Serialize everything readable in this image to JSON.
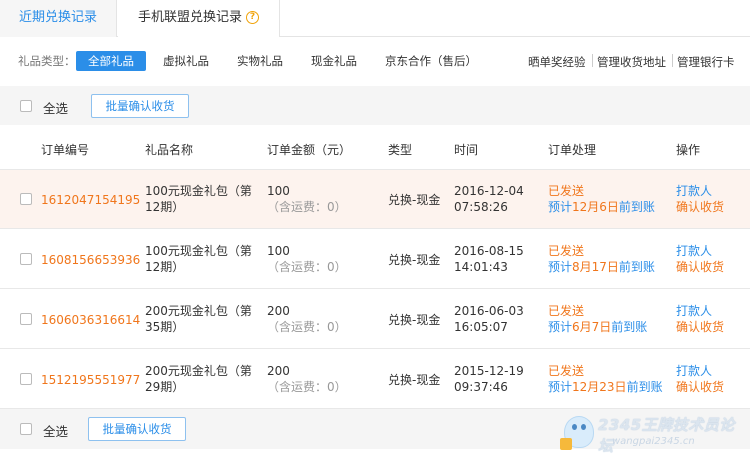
{
  "tabs": [
    {
      "label": "近期兑换记录",
      "active": true
    },
    {
      "label": "手机联盟兑换记录",
      "has_help_icon": true
    }
  ],
  "help_icon_glyph": "?",
  "filter": {
    "label": "礼品类型：",
    "options": [
      "全部礼品",
      "虚拟礼品",
      "实物礼品",
      "现金礼品",
      "京东合作（售后）"
    ],
    "selected": "全部礼品",
    "right_links": [
      "晒单奖经验",
      "管理收货地址",
      "管理银行卡"
    ]
  },
  "select_bar": {
    "select_all_label": "全选",
    "batch_button": "批量确认收货"
  },
  "table": {
    "columns": [
      "订单编号",
      "礼品名称",
      "订单金额（元）",
      "类型",
      "时间",
      "订单处理",
      "操作"
    ],
    "rows": [
      {
        "id": "1612047154195",
        "name1": "100元现金礼包（第",
        "name2": "12期）",
        "amount": "100",
        "fee": "（含运费：0）",
        "type": "兑换-现金",
        "date": "2016-12-04",
        "time": "07:58:26",
        "status": "已发送",
        "eta_prefix": "预计",
        "eta_date": "12月6日",
        "eta_suffix": "前到账",
        "action1": "打款人",
        "action2": "确认收货",
        "highlighted": true
      },
      {
        "id": "1608156653936",
        "name1": "100元现金礼包（第",
        "name2": "12期）",
        "amount": "100",
        "fee": "（含运费：0）",
        "type": "兑换-现金",
        "date": "2016-08-15",
        "time": "14:01:43",
        "status": "已发送",
        "eta_prefix": "预计",
        "eta_date": "8月17日",
        "eta_suffix": "前到账",
        "action1": "打款人",
        "action2": "确认收货",
        "highlighted": false
      },
      {
        "id": "1606036316614",
        "name1": "200元现金礼包（第",
        "name2": "35期）",
        "amount": "200",
        "fee": "（含运费：0）",
        "type": "兑换-现金",
        "date": "2016-06-03",
        "time": "16:05:07",
        "status": "已发送",
        "eta_prefix": "预计",
        "eta_date": "6月7日",
        "eta_suffix": "前到账",
        "action1": "打款人",
        "action2": "确认收货",
        "highlighted": false
      },
      {
        "id": "1512195551977",
        "name1": "200元现金礼包（第",
        "name2": "29期）",
        "amount": "200",
        "fee": "（含运费：0）",
        "type": "兑换-现金",
        "date": "2015-12-19",
        "time": "09:37:46",
        "status": "已发送",
        "eta_prefix": "预计",
        "eta_date": "12月23日",
        "eta_suffix": "前到账",
        "action1": "打款人",
        "action2": "确认收货",
        "highlighted": false
      }
    ]
  },
  "watermark": {
    "line1": "2345王牌技术员论坛",
    "line2": "wangpai2345.cn"
  },
  "colors": {
    "accent": "#2b8ee8",
    "order_id": "#f0761c",
    "status": "#f0761c",
    "row_highlight": "#fdf3ee"
  }
}
